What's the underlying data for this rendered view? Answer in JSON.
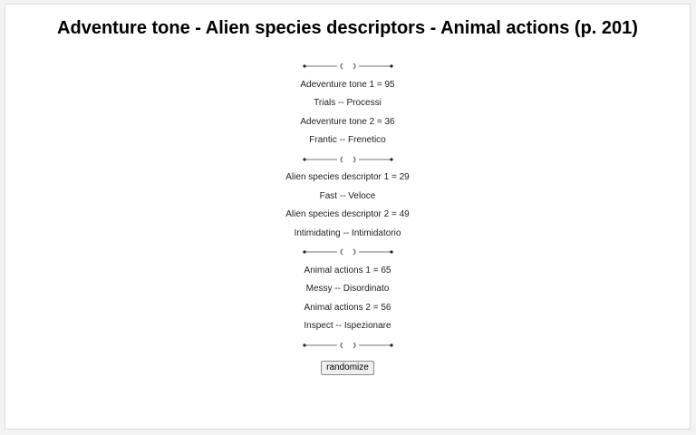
{
  "title": "Adventure tone - Alien species descriptors - Animal actions (p. 201)",
  "sections": {
    "adventure_tone": {
      "roll1": "Adeventure tone 1 = 95",
      "result1": "Trials -- Processi",
      "roll2": "Adeventure tone 2 = 36",
      "result2": "Frantic -- Frenetico"
    },
    "alien_species": {
      "roll1": "Alien species descriptor 1 = 29",
      "result1": "Fast -- Veloce",
      "roll2": "Alien species descriptor 2 = 49",
      "result2": "Intimidating -- Intimidatorio"
    },
    "animal_actions": {
      "roll1": "Animal actions 1 = 65",
      "result1": "Messy -- Disordinato",
      "roll2": "Animal actions 2 = 56",
      "result2": "Inspect -- Ispezionare"
    }
  },
  "button": {
    "label": "randomize"
  },
  "icons": {
    "divider": "ornamental-divider-icon"
  }
}
